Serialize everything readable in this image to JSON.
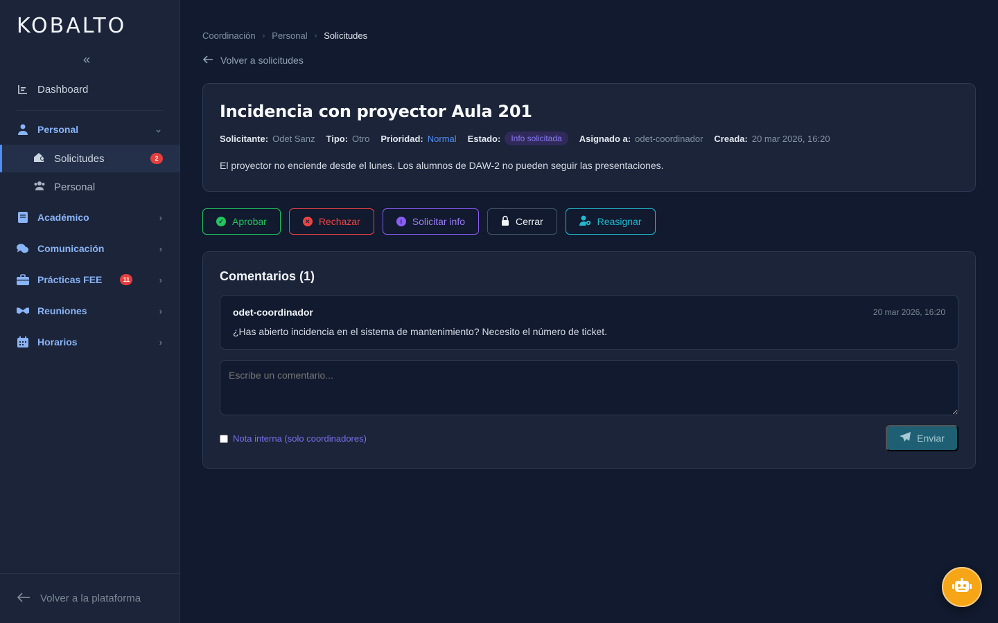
{
  "app": {
    "logo": "KOBALTO"
  },
  "sidebar": {
    "dashboard": "Dashboard",
    "personal_group": "Personal",
    "sub_items": [
      {
        "label": "Solicitudes",
        "badge": "2"
      },
      {
        "label": "Personal"
      }
    ],
    "groups": [
      {
        "label": "Académico"
      },
      {
        "label": "Comunicación"
      },
      {
        "label": "Prácticas FEE",
        "badge": "11"
      },
      {
        "label": "Reuniones"
      },
      {
        "label": "Horarios"
      }
    ],
    "footer": "Volver a la plataforma"
  },
  "breadcrumb": [
    "Coordinación",
    "Personal",
    "Solicitudes"
  ],
  "back_link": "Volver a solicitudes",
  "request": {
    "title": "Incidencia con proyector Aula 201",
    "solicitante_label": "Solicitante:",
    "solicitante": "Odet Sanz",
    "tipo_label": "Tipo:",
    "tipo": "Otro",
    "prioridad_label": "Prioridad:",
    "prioridad": "Normal",
    "estado_label": "Estado:",
    "estado": "Info solicitada",
    "asignado_label": "Asignado a:",
    "asignado": "odet-coordinador",
    "creada_label": "Creada:",
    "creada": "20 mar 2026, 16:20",
    "description": "El proyector no enciende desde el lunes. Los alumnos de DAW-2 no pueden seguir las presentaciones."
  },
  "actions": {
    "approve": "Aprobar",
    "reject": "Rechazar",
    "request_info": "Solicitar info",
    "close": "Cerrar",
    "reassign": "Reasignar"
  },
  "comments": {
    "title": "Comentarios (1)",
    "items": [
      {
        "author": "odet-coordinador",
        "date": "20 mar 2026, 16:20",
        "text": "¿Has abierto incidencia en el sistema de mantenimiento? Necesito el número de ticket."
      }
    ],
    "placeholder": "Escribe un comentario...",
    "internal_note": "Nota interna (solo coordinadores)",
    "send": "Enviar"
  },
  "colors": {
    "accent": "#4f8df5",
    "approve": "#22c55e",
    "reject": "#ef4444",
    "info": "#8b5cf6",
    "reassign": "#22b8cf",
    "fab": "#f5a516"
  }
}
